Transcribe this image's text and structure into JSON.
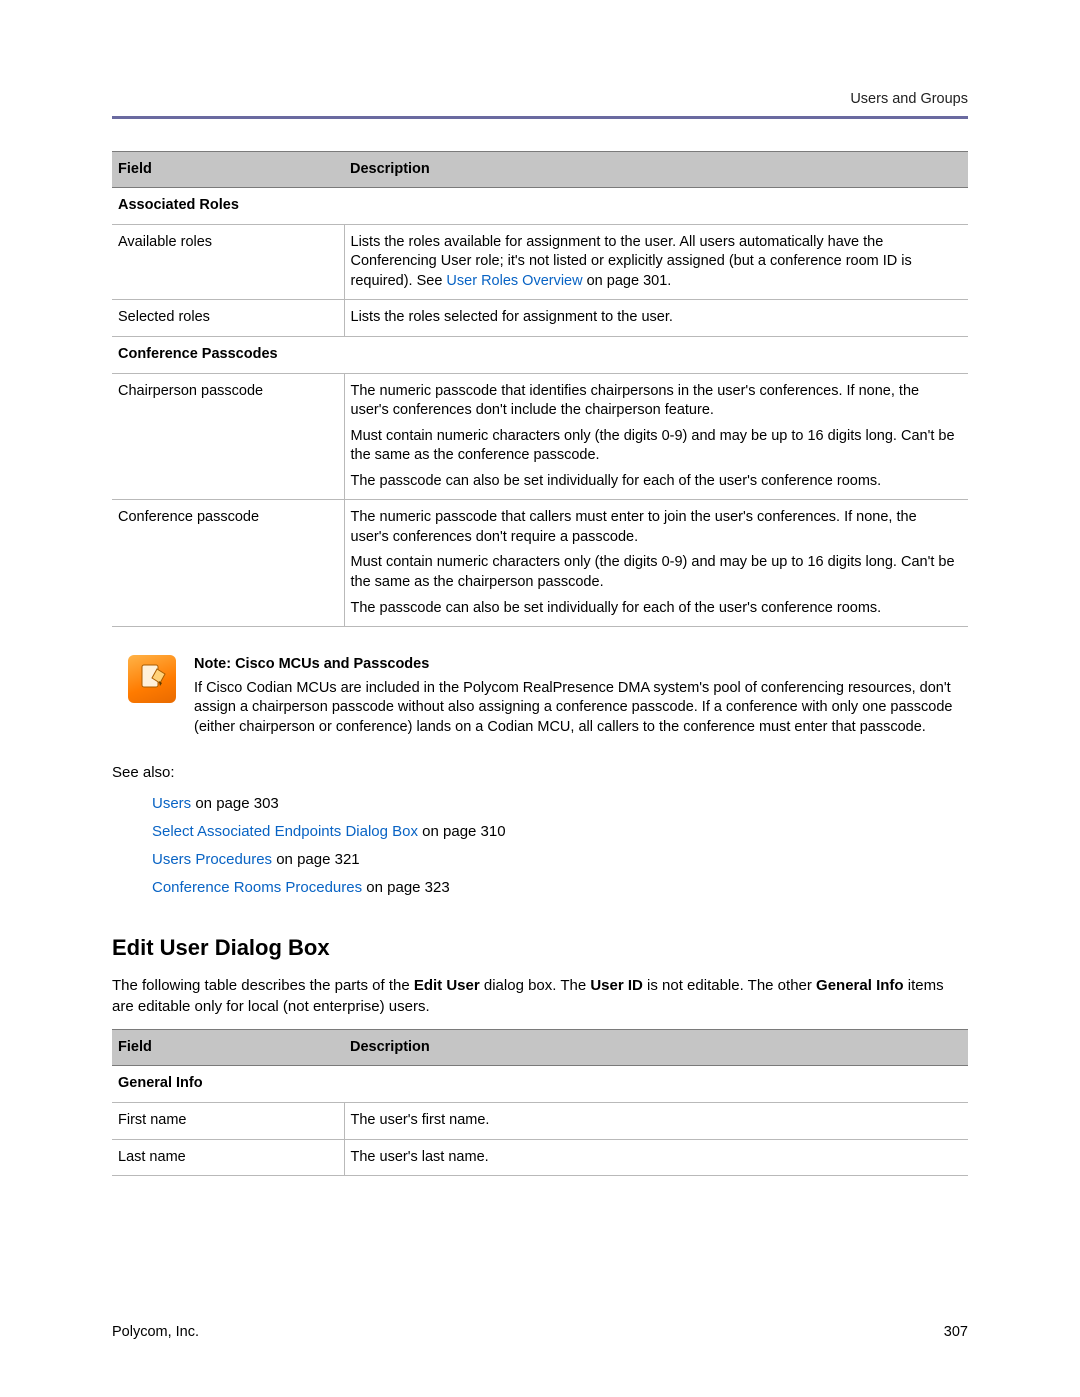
{
  "header": {
    "section": "Users and Groups"
  },
  "table1": {
    "headers": {
      "field": "Field",
      "description": "Description"
    },
    "section1": "Associated Roles",
    "rows1": [
      {
        "field": "Available roles",
        "desc": [
          {
            "pre": "Lists the roles available for assignment to the user. All users automatically have the Conferencing User role; it's not listed or explicitly assigned (but a conference room ID is required). See ",
            "link": "User Roles Overview",
            "post": " on page 301."
          }
        ]
      },
      {
        "field": "Selected roles",
        "desc": [
          {
            "text": "Lists the roles selected for assignment to the user."
          }
        ]
      }
    ],
    "section2": "Conference Passcodes",
    "rows2": [
      {
        "field": "Chairperson passcode",
        "desc": [
          {
            "text": "The numeric passcode that identifies chairpersons in the user's conferences. If none, the user's conferences don't include the chairperson feature."
          },
          {
            "text": "Must contain numeric characters only (the digits 0-9) and may be up to 16 digits long. Can't be the same as the conference passcode."
          },
          {
            "text": "The passcode can also be set individually for each of the user's conference rooms."
          }
        ]
      },
      {
        "field": "Conference passcode",
        "desc": [
          {
            "text": "The numeric passcode that callers must enter to join the user's conferences. If none, the user's conferences don't require a passcode."
          },
          {
            "text": "Must contain numeric characters only (the digits 0-9) and may be up to 16 digits long. Can't be the same as the chairperson passcode."
          },
          {
            "text": "The passcode can also be set individually for each of the user's conference rooms."
          }
        ]
      }
    ]
  },
  "note": {
    "title": "Note: Cisco MCUs and Passcodes",
    "body": "If Cisco Codian MCUs are included in the Polycom RealPresence DMA system's pool of conferencing resources, don't assign a chairperson passcode without also assigning a conference passcode. If a conference with only one passcode (either chairperson or conference) lands on a Codian MCU, all callers to the conference must enter that passcode."
  },
  "see_also": {
    "label": "See also:",
    "items": [
      {
        "link": "Users",
        "rest": " on page 303"
      },
      {
        "link": "Select Associated Endpoints Dialog Box",
        "rest": " on page 310"
      },
      {
        "link": "Users Procedures",
        "rest": " on page 321"
      },
      {
        "link": "Conference Rooms Procedures",
        "rest": " on page 323"
      }
    ]
  },
  "section": {
    "title": "Edit User Dialog Box",
    "intro_pre": "The following table describes the parts of the ",
    "intro_b1": "Edit User",
    "intro_mid1": " dialog box. The ",
    "intro_b2": "User ID",
    "intro_mid2": " is not editable. The other ",
    "intro_b3": "General Info",
    "intro_post": " items are editable only for local (not enterprise) users."
  },
  "table2": {
    "headers": {
      "field": "Field",
      "description": "Description"
    },
    "section1": "General Info",
    "rows": [
      {
        "field": "First name",
        "desc": "The user's first name."
      },
      {
        "field": "Last name",
        "desc": "The user's last name."
      }
    ]
  },
  "footer": {
    "company": "Polycom, Inc.",
    "page": "307"
  }
}
